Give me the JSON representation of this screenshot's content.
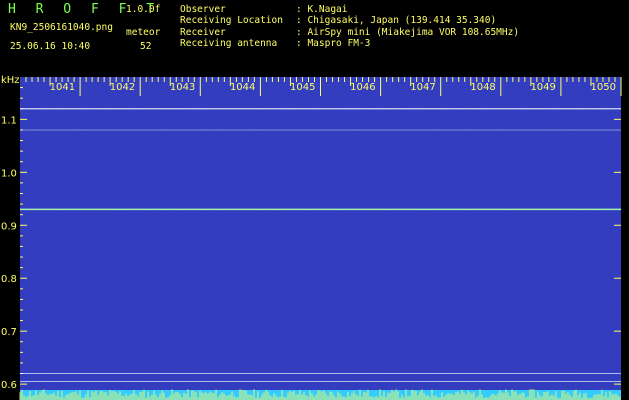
{
  "header": {
    "app_name": "H R O F F T",
    "version": "1.0.0f",
    "filename": "KN9_2506161040.png",
    "datetime": "25.06.16 10:40",
    "meteor_label": "meteor",
    "meteor_count": "52",
    "info": [
      {
        "key": "Observer",
        "value": ": K.Nagai"
      },
      {
        "key": "Receiving Location",
        "value": ": Chigasaki, Japan (139.414 35.340)"
      },
      {
        "key": "Receiver",
        "value": ": AirSpy mini (Miakejima VOR 108.65MHz)"
      },
      {
        "key": "Receiving antenna",
        "value": ": Maspro FM-3"
      }
    ]
  },
  "colors": {
    "background": "#05058a",
    "grid": "#8888ff",
    "label": "#FFFF66",
    "header_green": "#7CFF4A",
    "line_white": "#e8f0ff",
    "line_bright": "#aaffaa",
    "bottom_band": "#33ccff"
  },
  "chart_data": {
    "type": "heatmap",
    "ylabel": "kHz",
    "x_tick_labels": [
      "1041",
      "1042",
      "1043",
      "1044",
      "1045",
      "1046",
      "1047",
      "1048",
      "1049",
      "1050"
    ],
    "x_range_minutes": [
      1040,
      1050
    ],
    "y_ticks": [
      0.6,
      0.7,
      0.8,
      0.9,
      1.0,
      1.1
    ],
    "y_tick_labels": [
      "0.6",
      "0.7",
      "0.8",
      "0.9",
      "1.0",
      "1.1"
    ],
    "ylim_khz": [
      0.57,
      1.18
    ],
    "horizontal_lines_khz": [
      {
        "freq": 1.12,
        "intensity": "bright"
      },
      {
        "freq": 1.08,
        "intensity": "faint"
      },
      {
        "freq": 0.93,
        "intensity": "strong"
      },
      {
        "freq": 0.62,
        "intensity": "medium"
      },
      {
        "freq": 0.605,
        "intensity": "medium"
      }
    ]
  }
}
